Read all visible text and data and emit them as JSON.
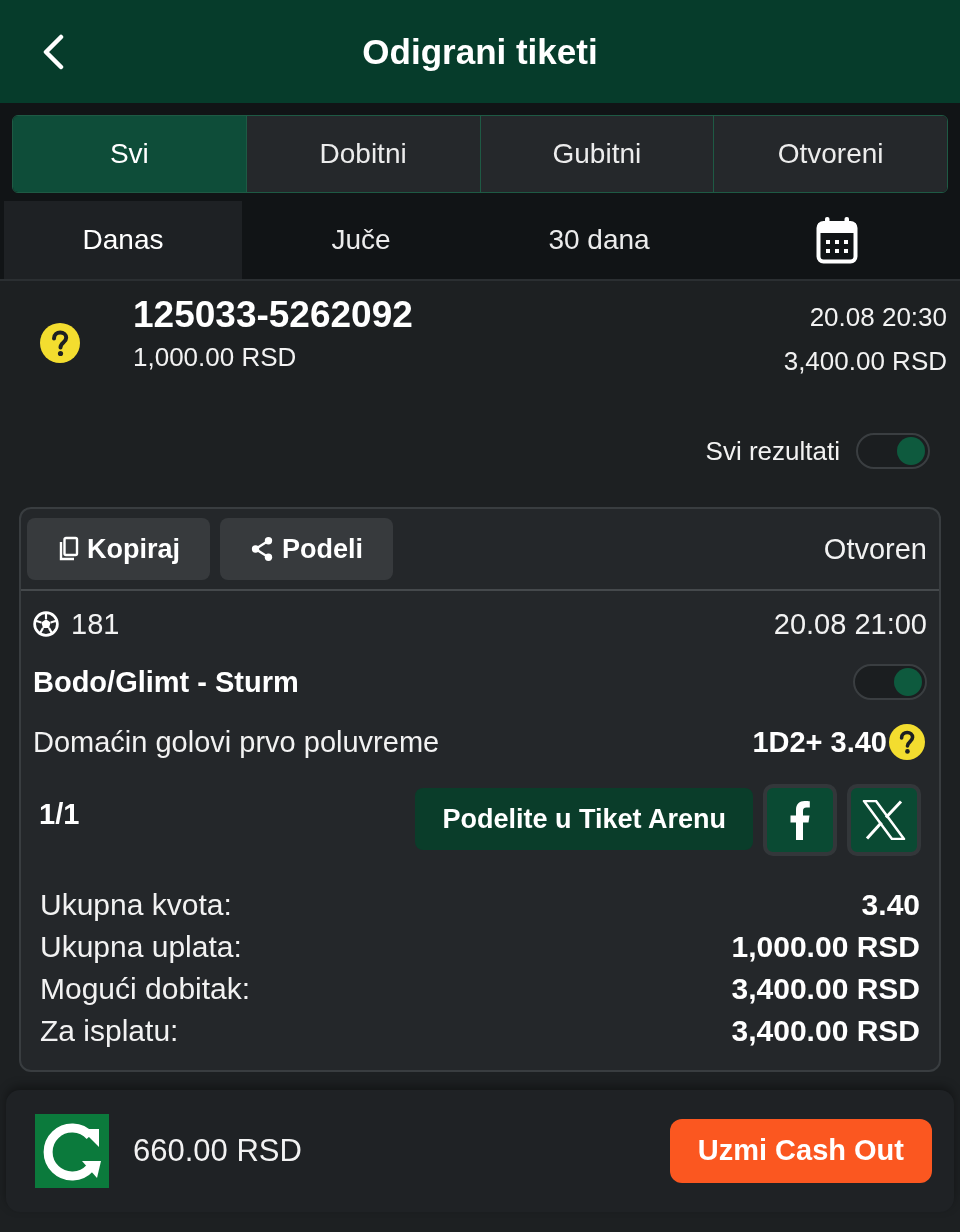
{
  "header": {
    "title": "Odigrani tiketi"
  },
  "tabs": [
    {
      "label": "Svi",
      "selected": true
    },
    {
      "label": "Dobitni",
      "selected": false
    },
    {
      "label": "Gubitni",
      "selected": false
    },
    {
      "label": "Otvoreni",
      "selected": false
    }
  ],
  "periods": [
    {
      "kind": "text",
      "label": "Danas",
      "selected": true
    },
    {
      "kind": "text",
      "label": "Juče",
      "selected": false
    },
    {
      "kind": "text",
      "label": "30 dana",
      "selected": false
    },
    {
      "kind": "calendar",
      "selected": false
    }
  ],
  "ticket": {
    "number": "125033-5262092",
    "stake": "1,000.00 RSD",
    "date": "20.08 20:30",
    "payout": "3,400.00 RSD",
    "all_results": {
      "label": "Svi rezultati",
      "on": true
    },
    "actions": [
      {
        "kind": "copy",
        "label": "Kopiraj"
      },
      {
        "kind": "share",
        "label": "Podeli"
      }
    ],
    "status": "Otvoren",
    "events": [
      {
        "code": "181",
        "date": "20.08 21:00",
        "match": "Bodo/Glimt - Sturm",
        "on": true,
        "market": "Domaćin golovi prvo poluvreme",
        "pick": "1D2+",
        "odds": "3.40"
      }
    ],
    "count": "1/1",
    "arena_button": "Podelite u Tiket Arenu",
    "social": [
      {
        "kind": "facebook"
      },
      {
        "kind": "x"
      }
    ],
    "summary": [
      {
        "label": "Ukupna kvota:",
        "value": "3.40"
      },
      {
        "label": "Ukupna uplata:",
        "value": "1,000.00 RSD"
      },
      {
        "label": "Mogući dobitak:",
        "value": "3,400.00 RSD"
      },
      {
        "label": "Za isplatu:",
        "value": "3,400.00 RSD"
      }
    ]
  },
  "cash_out": {
    "amount": "660.00 RSD",
    "button": "Uzmi Cash Out"
  }
}
